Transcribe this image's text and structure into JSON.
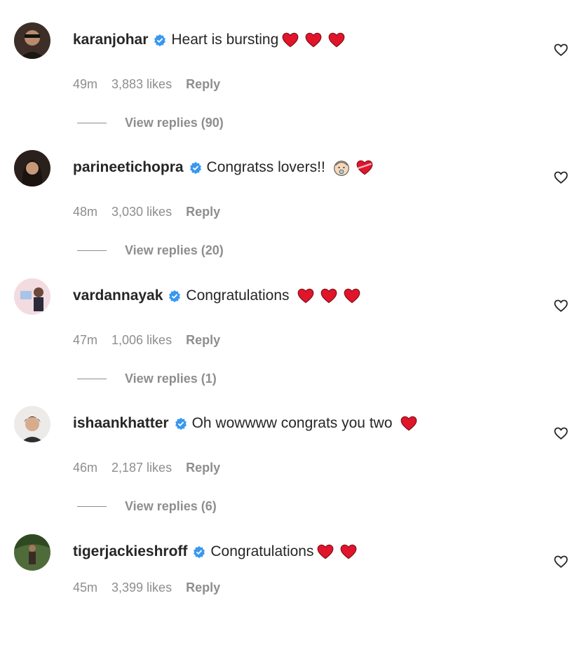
{
  "colors": {
    "heart": "#e0152b",
    "verified": "#3897f0",
    "muted": "#8e8e8e",
    "text": "#262626"
  },
  "comments": [
    {
      "username": "karanjohar",
      "text": "Heart is bursting",
      "emojis": [
        "red-heart",
        "red-heart",
        "red-heart"
      ],
      "time": "49m",
      "likes": "3,883 likes",
      "reply": "Reply",
      "view_replies": "View replies (90)"
    },
    {
      "username": "parineetichopra",
      "text": "Congratss lovers!!",
      "emojis": [
        "baby-face",
        "heart-with-ribbon"
      ],
      "time": "48m",
      "likes": "3,030 likes",
      "reply": "Reply",
      "view_replies": "View replies (20)"
    },
    {
      "username": "vardannayak",
      "text": "Congratulations",
      "emojis": [
        "red-heart",
        "red-heart",
        "red-heart"
      ],
      "time": "47m",
      "likes": "1,006 likes",
      "reply": "Reply",
      "view_replies": "View replies (1)"
    },
    {
      "username": "ishaankhatter",
      "text": "Oh wowwww congrats you two",
      "emojis": [
        "red-heart"
      ],
      "time": "46m",
      "likes": "2,187 likes",
      "reply": "Reply",
      "view_replies": "View replies (6)"
    },
    {
      "username": "tigerjackieshroff",
      "text": "Congratulations",
      "emojis": [
        "red-heart",
        "red-heart"
      ],
      "time": "45m",
      "likes": "3,399 likes",
      "reply": "Reply",
      "view_replies": ""
    }
  ]
}
